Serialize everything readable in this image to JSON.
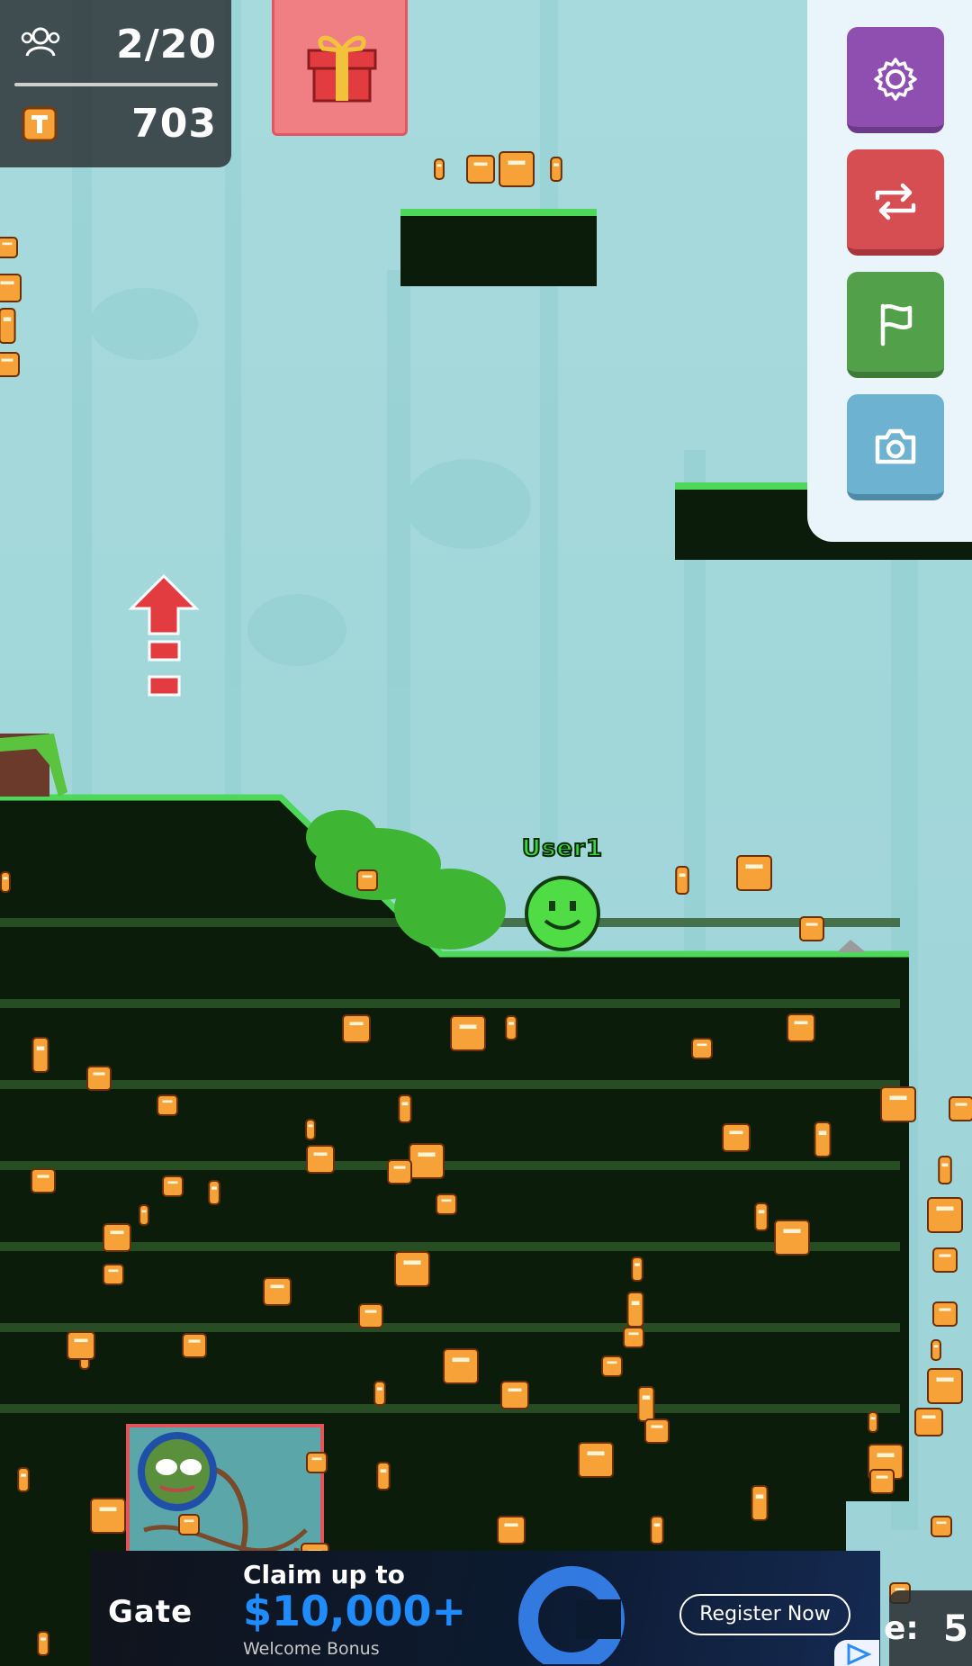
{
  "hud": {
    "players_count": "2/20",
    "coins_count": "703",
    "players_icon": "users-icon",
    "coin_icon": "coin-icon"
  },
  "gift_button": {
    "icon": "gift-icon"
  },
  "side_menu": [
    {
      "name": "settings-button",
      "icon": "gear-icon",
      "color": "#8e4fb0"
    },
    {
      "name": "swap-button",
      "icon": "swap-arrows-icon",
      "color": "#d64d52"
    },
    {
      "name": "checkpoint-button",
      "icon": "flag-icon",
      "color": "#52a14a"
    },
    {
      "name": "screenshot-button",
      "icon": "camera-icon",
      "color": "#6eb2d2"
    }
  ],
  "player": {
    "name": "User1",
    "color": "#4fdc45"
  },
  "bottom_counter": {
    "label": "e:",
    "value": "5"
  },
  "ad": {
    "brand": "Gate",
    "headline": "Claim up to",
    "amount": "$10,000+",
    "subline": "Welcome Bonus",
    "cta": "Register Now"
  },
  "colors": {
    "sky": "#a7dadc",
    "ground": "#0b1c0b",
    "grass": "#4ed85a",
    "coin": "#f7a238",
    "arrow": "#e23b40"
  }
}
